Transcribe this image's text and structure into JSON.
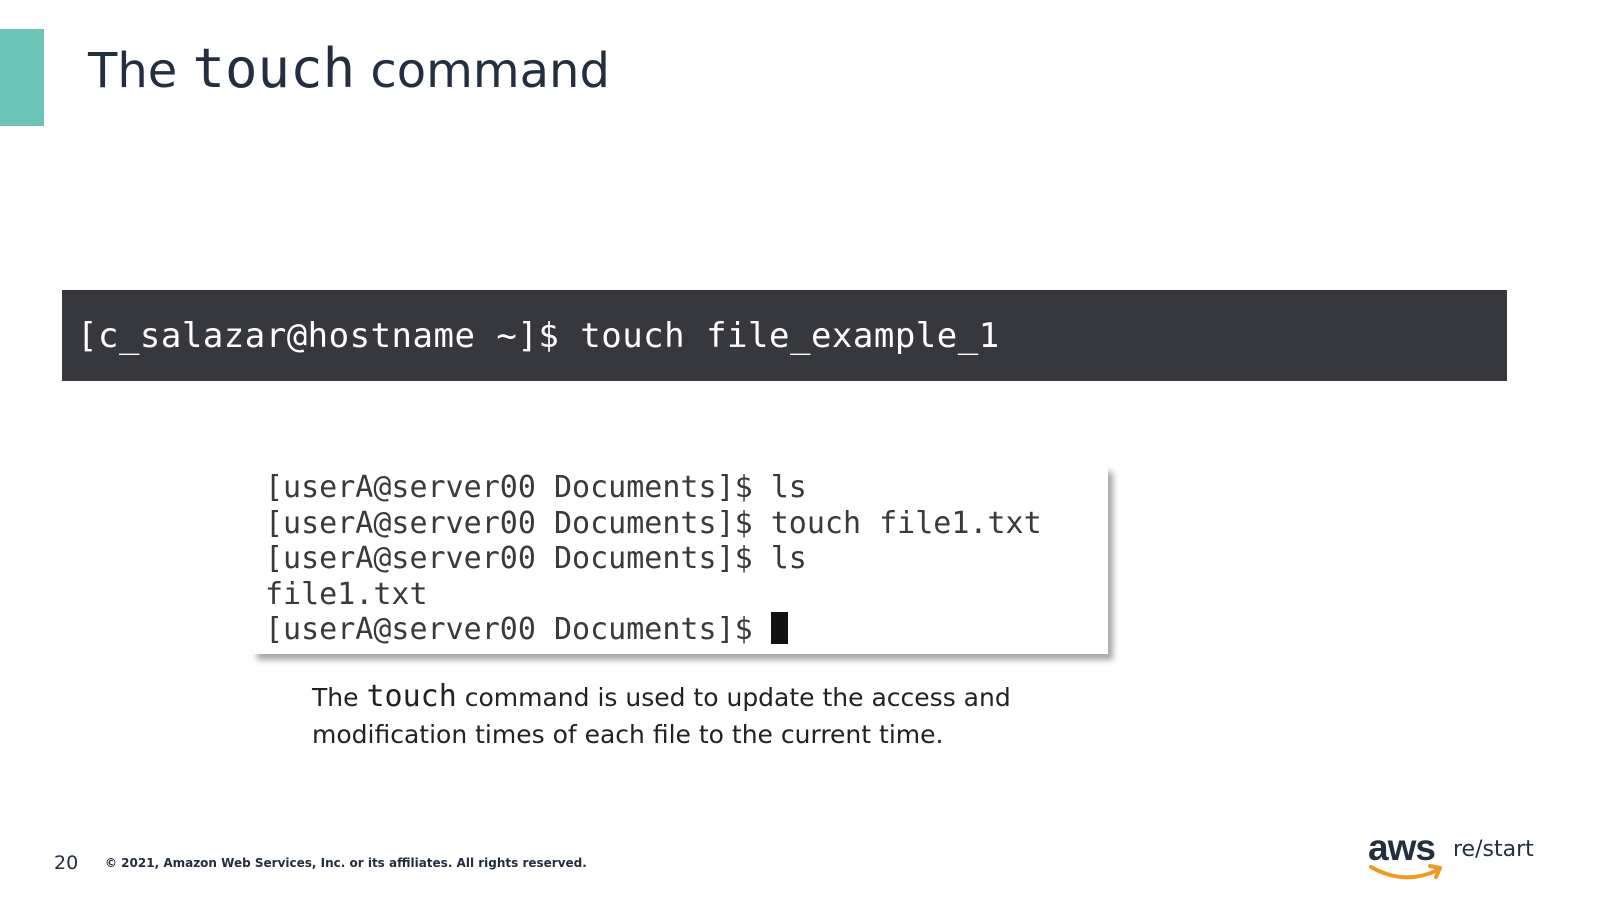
{
  "slide": {
    "title_prefix": "The ",
    "title_code": "touch",
    "title_suffix": " command",
    "accent_color": "#6cc4b6"
  },
  "command_banner": {
    "text": "[c_salazar@hostname ~]$ touch file_example_1",
    "background": "#37383d"
  },
  "terminal": {
    "lines": [
      "[userA@server00 Documents]$ ls",
      "[userA@server00 Documents]$ touch file1.txt",
      "[userA@server00 Documents]$ ls",
      "file1.txt",
      "[userA@server00 Documents]$ "
    ]
  },
  "caption": {
    "prefix": "The ",
    "code": "touch",
    "suffix": " command is used to update the access and modification times of each file to the current time."
  },
  "footer": {
    "page_number": "20",
    "copyright": "© 2021, Amazon Web Services, Inc. or its affiliates. All rights reserved.",
    "logo_text": "aws",
    "logo_subtext": "re/start",
    "logo_smile_color": "#f29a1f"
  }
}
